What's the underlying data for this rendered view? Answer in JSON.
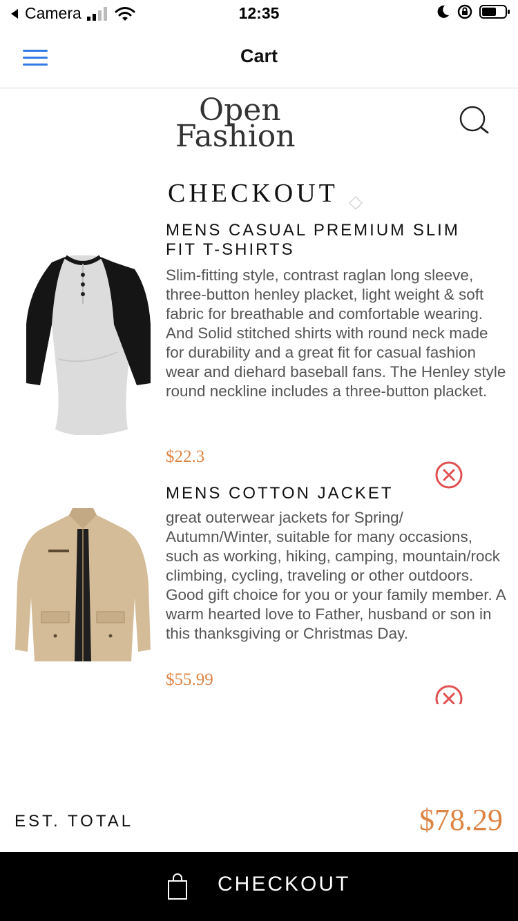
{
  "status_bar": {
    "back_app": "Camera",
    "time": "12:35"
  },
  "nav": {
    "title": "Cart",
    "menu_icon": "hamburger-menu-icon"
  },
  "brand": {
    "line1": "Open",
    "line2": "Fashion",
    "search_icon": "search-icon"
  },
  "page": {
    "title": "CHECKOUT"
  },
  "items": [
    {
      "name": "MENS CASUAL PREMIUM SLIM FIT T-SHIRTS",
      "description": "Slim-fitting style, contrast raglan long sleeve, three-button henley placket, light weight & soft fabric for breathable and comfortable wearing. And Solid stitched shirts with round neck made for durability and a great fit for casual fashion wear and diehard baseball fans. The Henley style round neckline includes a three-button placket.",
      "price": "$22.3",
      "image_icon": "raglan-tshirt-image"
    },
    {
      "name": "MENS COTTON JACKET",
      "description": "great outerwear jackets for Spring/ Autumn/Winter, suitable for many occasions, such as working, hiking, camping, mountain/rock climbing, cycling, traveling or other outdoors. Good gift choice for you or your family member. A warm hearted love to Father, husband or son in this thanksgiving or Christmas Day.",
      "price": "$55.99",
      "image_icon": "cotton-jacket-image"
    }
  ],
  "summary": {
    "total_label": "EST. TOTAL",
    "total_value": "$78.29"
  },
  "footer": {
    "checkout_label": "CHECKOUT",
    "bag_icon": "shopping-bag-icon"
  },
  "colors": {
    "accent_price": "#dd8444",
    "remove_icon": "#e05050",
    "menu_icon": "#2f7ae5",
    "footer_bg": "#000000"
  }
}
